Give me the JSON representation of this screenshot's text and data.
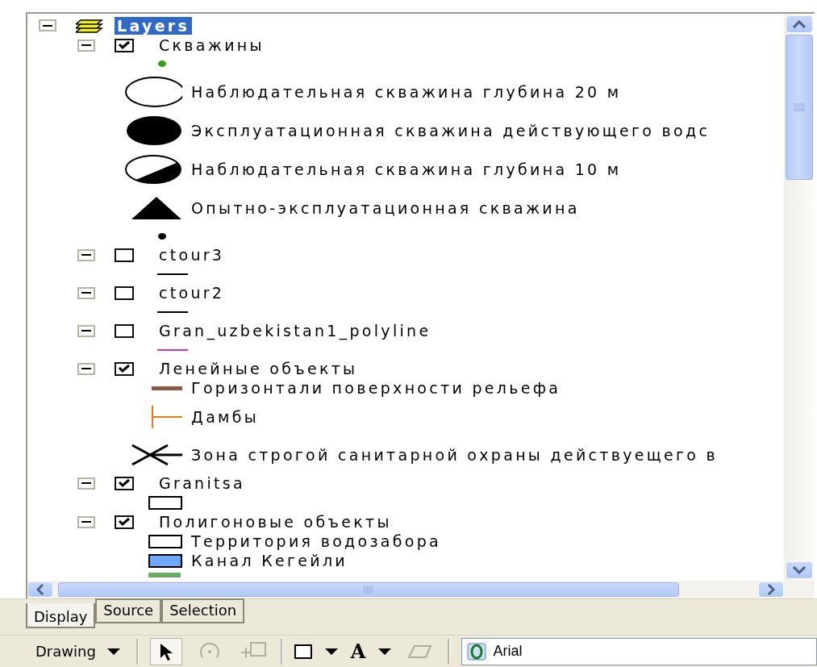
{
  "tree": {
    "root": {
      "label": "Layers",
      "expanded": true,
      "selected": true
    },
    "layers": [
      {
        "label": "Скважины",
        "expanded": true,
        "checked": true,
        "legend": [
          {
            "kind": "dot",
            "color": "#3a9a1a"
          },
          {
            "kind": "hollow-circle",
            "label": "Наблюдательная скважина глубина 20 м"
          },
          {
            "kind": "filled-circle",
            "label": "Эксплуатационная скважина действующего водс"
          },
          {
            "kind": "half-circle",
            "label": "Наблюдательная скважина глубина 10 м"
          },
          {
            "kind": "triangle",
            "label": "Опытно-эксплуатационная скважина"
          },
          {
            "kind": "dot",
            "color": "#000000"
          }
        ]
      },
      {
        "label": "ctour3",
        "expanded": true,
        "checked": false,
        "legend": [
          {
            "kind": "line",
            "color": "#000000"
          }
        ]
      },
      {
        "label": "ctour2",
        "expanded": true,
        "checked": false,
        "legend": [
          {
            "kind": "line",
            "color": "#000000"
          }
        ]
      },
      {
        "label": "Gran_uzbekistan1_polyline",
        "expanded": true,
        "checked": false,
        "legend": [
          {
            "kind": "line",
            "color": "#cc33cc"
          }
        ]
      },
      {
        "label": "Ленейные объекты",
        "expanded": true,
        "checked": true,
        "legend": [
          {
            "kind": "thick-line",
            "color": "#8b5a44",
            "label": "Горизонтали поверхности рельефа"
          },
          {
            "kind": "dam",
            "color": "#e07b1a",
            "label": "Дамбы"
          },
          {
            "kind": "cross",
            "label": "Зона строгой санитарной охраны действуещего в"
          }
        ]
      },
      {
        "label": "Granitsa",
        "expanded": true,
        "checked": true,
        "legend": [
          {
            "kind": "rect-outline"
          }
        ]
      },
      {
        "label": "Полигоновые объекты",
        "expanded": true,
        "checked": true,
        "legend": [
          {
            "kind": "rect-outline",
            "label": "Территория водозабора"
          },
          {
            "kind": "rect",
            "color": "#6fa8ff",
            "label": "Канал Кегейли"
          },
          {
            "kind": "partial",
            "color": "#6aaa64"
          }
        ]
      }
    ]
  },
  "tabs": [
    {
      "label": "Display",
      "selected": true
    },
    {
      "label": "Source",
      "selected": false
    },
    {
      "label": "Selection",
      "selected": false
    }
  ],
  "toolbar": {
    "drawing": "Drawing",
    "select_tool": {
      "selected": true
    },
    "rotate_tool": {
      "disabled": true
    },
    "zoom_tool": {
      "disabled": true
    },
    "text_tool": "A",
    "vertices_tool": {
      "disabled": true
    },
    "font": "Arial"
  }
}
